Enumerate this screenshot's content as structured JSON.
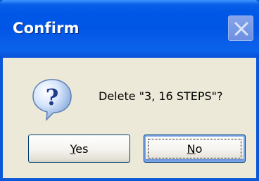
{
  "dialog": {
    "title": "Confirm",
    "message": "Delete \"3, 16 STEPS\"?",
    "icon": "question-icon"
  },
  "buttons": {
    "yes": {
      "mnemonic": "Y",
      "rest": "es"
    },
    "no": {
      "mnemonic": "N",
      "rest": "o",
      "focused": true
    }
  },
  "colors": {
    "titlebar": "#0058e6",
    "dialog_bg": "#ece9d8",
    "button_border": "#003c74",
    "close_button": "#8ea5e6"
  }
}
